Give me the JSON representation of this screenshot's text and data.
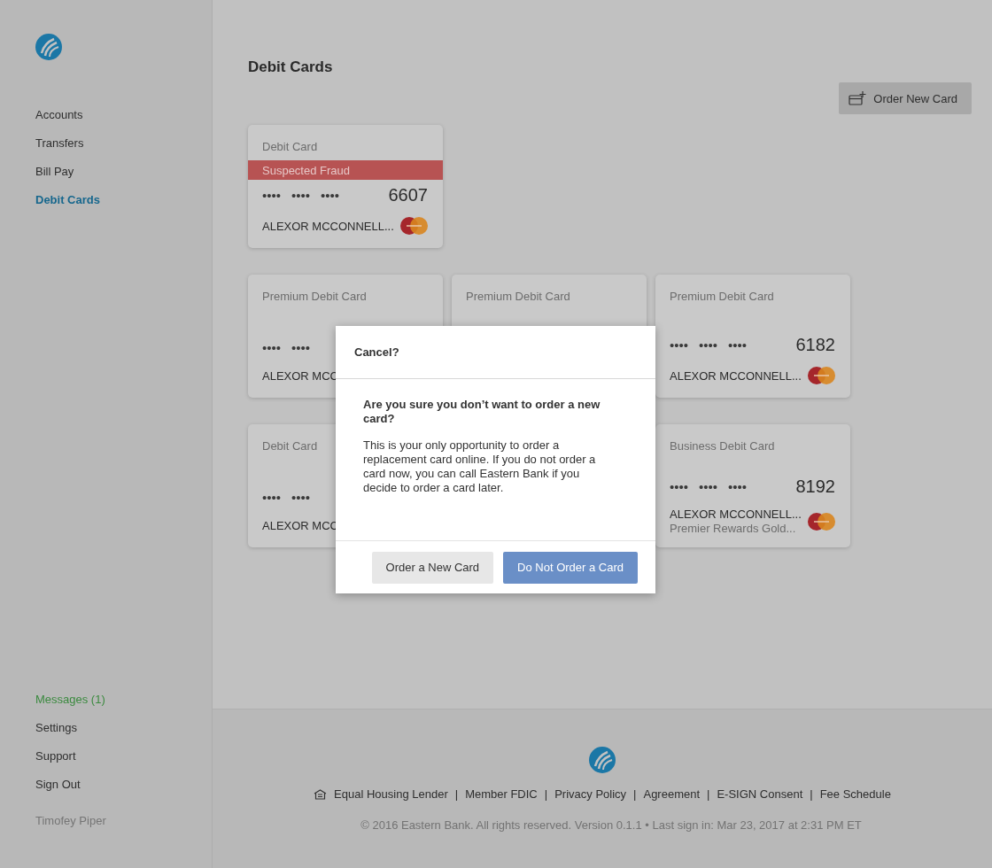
{
  "sidebar": {
    "nav": [
      {
        "label": "Accounts",
        "selected": false
      },
      {
        "label": "Transfers",
        "selected": false
      },
      {
        "label": "Bill Pay",
        "selected": false
      },
      {
        "label": "Debit Cards",
        "selected": true
      }
    ],
    "bottom": [
      {
        "label": "Messages (1)",
        "kind": "alert"
      },
      {
        "label": "Settings",
        "kind": "link"
      },
      {
        "label": "Support",
        "kind": "link"
      },
      {
        "label": "Sign Out",
        "kind": "link"
      }
    ],
    "user": "Timofey Piper"
  },
  "page": {
    "title": "Debit Cards",
    "action": "Order New Card"
  },
  "card_rows": [
    [
      {
        "title": "Debit Card",
        "fraud": "Suspected Fraud",
        "masked": [
          "••••",
          "••••",
          "••••"
        ],
        "last4": "6607",
        "name": "ALEXOR MCCONNELL...",
        "network_logo": true
      }
    ],
    [
      {
        "title": "Premium Debit Card",
        "masked": [
          "••••",
          "••••"
        ],
        "name": "ALEXOR MCC",
        "network_logo": false
      },
      {
        "title": "Premium Debit Card",
        "network_logo": false
      },
      {
        "title": "Premium Debit Card",
        "masked": [
          "••••",
          "••••",
          "••••"
        ],
        "last4": "6182",
        "name": "ALEXOR MCCONNELL...",
        "network_logo": true
      }
    ],
    [
      {
        "title": "Debit Card",
        "masked": [
          "••••",
          "••••"
        ],
        "name": "ALEXOR MCC",
        "network_logo": false
      },
      {
        "title": "Business Debit Card",
        "masked": [
          "••••",
          "••••",
          "••••"
        ],
        "last4": "8192",
        "name": "ALEXOR MCCONNELL...",
        "subtitle": "Premier Rewards Gold...",
        "network_logo": true
      }
    ]
  ],
  "dialog": {
    "title": "Cancel?",
    "heading": "Are you sure you don’t want to order a new card?",
    "body": "This is your only opportunity to order a replacement card online. If you do not order a card now, you can call Eastern Bank if you decide to order a card later.",
    "buttons": [
      {
        "label": "Order a New Card",
        "kind": "secondary"
      },
      {
        "label": "Do Not Order a Card",
        "kind": "primary"
      }
    ]
  },
  "footer": {
    "separator": "|",
    "links": [
      "Equal Housing Lender",
      "Member FDIC",
      "Privacy Policy",
      "Agreement",
      "E-SIGN Consent",
      "Fee Schedule"
    ],
    "copyright": "© 2016 Eastern Bank. All rights reserved. Version 0.1.1 • Last sign in: Mar 23, 2017 at 2:31 PM ET"
  }
}
